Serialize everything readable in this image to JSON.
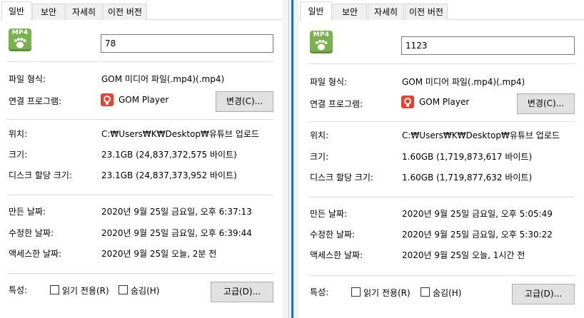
{
  "tabs": [
    "일반",
    "보안",
    "자세히",
    "이전 버전"
  ],
  "labels": {
    "file_type": "파일 형식:",
    "opens_with": "연결 프로그램:",
    "location": "위치:",
    "size": "크기:",
    "size_on_disk": "디스크 할당 크기:",
    "created": "만든 날짜:",
    "modified": "수정한 날짜:",
    "accessed": "액세스한 날짜:",
    "attributes": "특성:"
  },
  "buttons": {
    "change": "변경(C)...",
    "advanced": "고급(D)..."
  },
  "checkboxes": {
    "readonly": "읽기 전용(R)",
    "hidden": "숨김(H)"
  },
  "icon_text": "MP4",
  "left": {
    "file_name": "78",
    "file_type": "GOM 미디어 파일(.mp4)(.mp4)",
    "app_name": "GOM Player",
    "location": "C:₩Users₩K₩Desktop₩유튜브 업로드",
    "size": "23.1GB (24,837,372,575 바이트)",
    "size_on_disk": "23.1GB (24,837,373,952 바이트)",
    "created": "2020년 9월 25일 금요일, 오후 6:37:13",
    "modified": "2020년 9월 25일 금요일, 오후 6:39:44",
    "accessed": "2020년 9월 25일 오늘, 2분 전"
  },
  "right": {
    "file_name": "1123",
    "file_type": "GOM 미디어 파일(.mp4)(.mp4)",
    "app_name": "GOM Player",
    "location": "C:₩Users₩K₩Desktop₩유튜브 업로드",
    "size": "1.60GB (1,719,873,617 바이트)",
    "size_on_disk": "1.60GB (1,719,877,632 바이트)",
    "created": "2020년 9월 25일 금요일, 오후 5:05:49",
    "modified": "2020년 9월 25일 금요일, 오후 5:30:22",
    "accessed": "2020년 9월 25일 오늘, 1시간 전"
  },
  "colors": {
    "icon_green": "#7ab24f",
    "app_red": "#e8422f",
    "focus_blue": "#1f6fd0"
  }
}
